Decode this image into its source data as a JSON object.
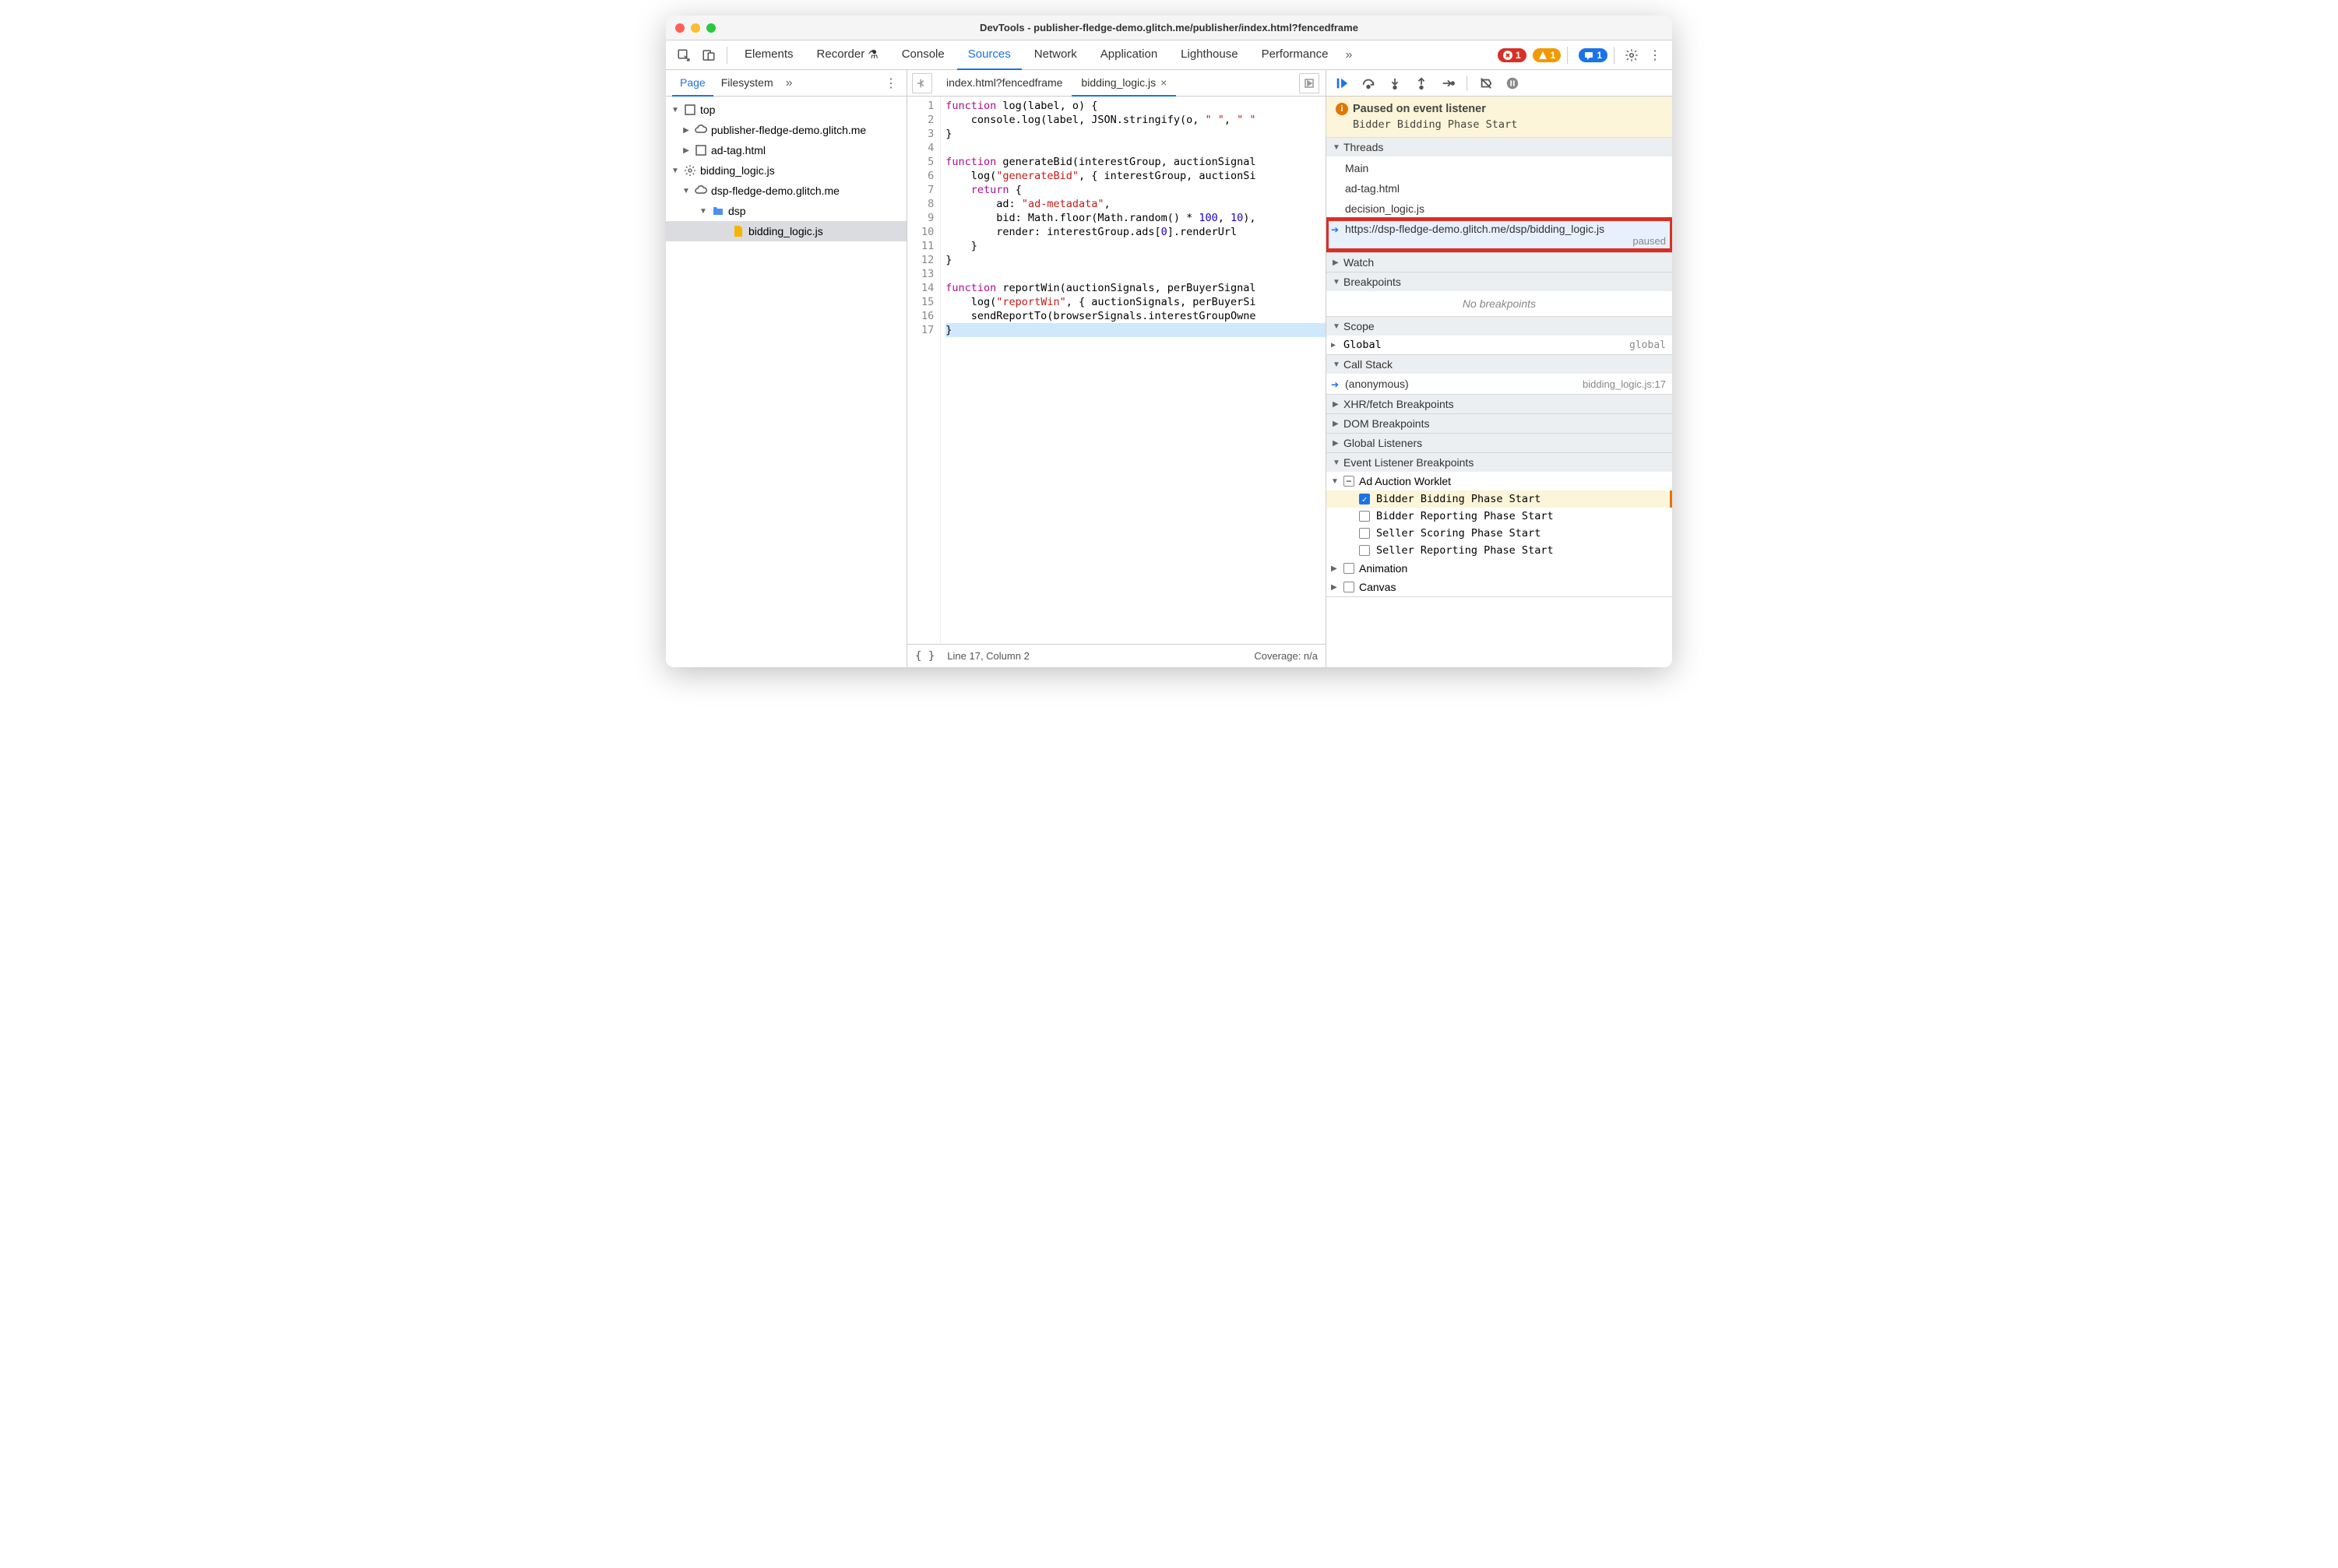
{
  "window_title": "DevTools - publisher-fledge-demo.glitch.me/publisher/index.html?fencedframe",
  "main_tabs": [
    "Elements",
    "Recorder",
    "Console",
    "Sources",
    "Network",
    "Application",
    "Lighthouse",
    "Performance"
  ],
  "active_main_tab": "Sources",
  "badges": {
    "errors": "1",
    "warnings": "1",
    "messages": "1"
  },
  "sidebar": {
    "tabs": [
      "Page",
      "Filesystem"
    ],
    "active": "Page",
    "tree": {
      "top": "top",
      "domain1": "publisher-fledge-demo.glitch.me",
      "file1": "ad-tag.html",
      "worklet": "bidding_logic.js",
      "domain2": "dsp-fledge-demo.glitch.me",
      "folder": "dsp",
      "file2": "bidding_logic.js"
    }
  },
  "editor_tabs": [
    {
      "label": "index.html?fencedframe",
      "active": false,
      "closable": false
    },
    {
      "label": "bidding_logic.js",
      "active": true,
      "closable": true
    }
  ],
  "code_lines": [
    {
      "n": 1,
      "html": "<span class='kw'>function</span> log(label, o) {"
    },
    {
      "n": 2,
      "html": "    console.log(label, JSON.stringify(o, <span class='str'>\" \"</span>, <span class='str'>\" \"</span>"
    },
    {
      "n": 3,
      "html": "}"
    },
    {
      "n": 4,
      "html": ""
    },
    {
      "n": 5,
      "html": "<span class='kw'>function</span> generateBid(interestGroup, auctionSignal"
    },
    {
      "n": 6,
      "html": "    log(<span class='str'>\"generateBid\"</span>, { interestGroup, auctionSi"
    },
    {
      "n": 7,
      "html": "    <span class='kw'>return</span> {"
    },
    {
      "n": 8,
      "html": "        ad: <span class='str'>\"ad-metadata\"</span>,"
    },
    {
      "n": 9,
      "html": "        bid: Math.floor(Math.random() * <span class='num'>100</span>, <span class='num'>10</span>),"
    },
    {
      "n": 10,
      "html": "        render: interestGroup.ads[<span class='num'>0</span>].renderUrl"
    },
    {
      "n": 11,
      "html": "    }"
    },
    {
      "n": 12,
      "html": "}"
    },
    {
      "n": 13,
      "html": ""
    },
    {
      "n": 14,
      "html": "<span class='kw'>function</span> reportWin(auctionSignals, perBuyerSignal"
    },
    {
      "n": 15,
      "html": "    log(<span class='str'>\"reportWin\"</span>, { auctionSignals, perBuyerSi"
    },
    {
      "n": 16,
      "html": "    sendReportTo(browserSignals.interestGroupOwne"
    },
    {
      "n": 17,
      "html": "}",
      "hl": true
    }
  ],
  "statusbar": {
    "pos": "Line 17, Column 2",
    "coverage": "Coverage: n/a"
  },
  "debugger": {
    "paused_title": "Paused on event listener",
    "paused_sub": "Bidder Bidding Phase Start",
    "threads": {
      "label": "Threads",
      "items": [
        "Main",
        "ad-tag.html",
        "decision_logic.js"
      ],
      "current": "https://dsp-fledge-demo.glitch.me/dsp/bidding_logic.js",
      "current_state": "paused"
    },
    "watch": "Watch",
    "breakpoints": {
      "label": "Breakpoints",
      "empty": "No breakpoints"
    },
    "scope": {
      "label": "Scope",
      "global": "Global",
      "global_val": "global"
    },
    "callstack": {
      "label": "Call Stack",
      "frame": "(anonymous)",
      "loc": "bidding_logic.js:17"
    },
    "xhr": "XHR/fetch Breakpoints",
    "dom": "DOM Breakpoints",
    "listeners": "Global Listeners",
    "event_bp": {
      "label": "Event Listener Breakpoints",
      "group": "Ad Auction Worklet",
      "items": [
        {
          "label": "Bidder Bidding Phase Start",
          "checked": true,
          "hl": true
        },
        {
          "label": "Bidder Reporting Phase Start",
          "checked": false
        },
        {
          "label": "Seller Scoring Phase Start",
          "checked": false
        },
        {
          "label": "Seller Reporting Phase Start",
          "checked": false
        }
      ],
      "animation": "Animation",
      "canvas": "Canvas"
    }
  }
}
